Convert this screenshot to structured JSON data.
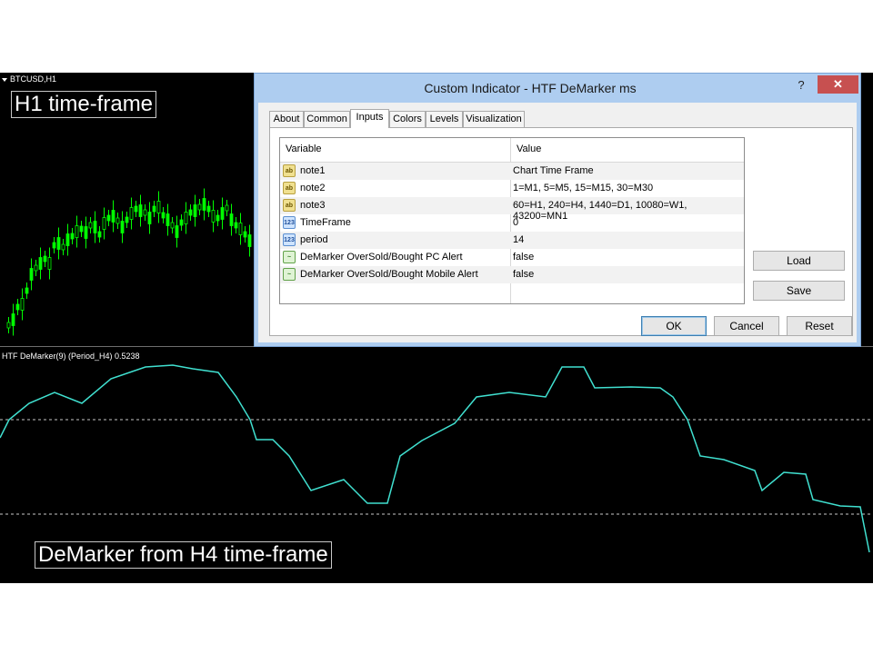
{
  "chart": {
    "symbol": "BTCUSD,H1",
    "top_label": "H1 time-frame",
    "indicator_label": "HTF DeMarker(9) (Period_H4) 0.5238",
    "bottom_label": "DeMarker from H4 time-frame",
    "candle_color": "#00ff00",
    "line_color": "#40e0d0",
    "background": "#000000"
  },
  "dialog": {
    "title": "Custom Indicator - HTF DeMarker ms",
    "help": "?",
    "close": "✕",
    "tabs": [
      {
        "label": "About"
      },
      {
        "label": "Common"
      },
      {
        "label": "Inputs"
      },
      {
        "label": "Colors"
      },
      {
        "label": "Levels"
      },
      {
        "label": "Visualization"
      }
    ],
    "active_tab": "Inputs",
    "grid": {
      "headers": {
        "variable": "Variable",
        "value": "Value"
      },
      "rows": [
        {
          "icon": "ab-icon",
          "variable": "note1",
          "value": "Chart Time Frame"
        },
        {
          "icon": "ab-icon",
          "variable": "note2",
          "value": "1=M1, 5=M5, 15=M15, 30=M30"
        },
        {
          "icon": "ab-icon",
          "variable": "note3",
          "value": "60=H1, 240=H4, 1440=D1, 10080=W1, 43200=MN1"
        },
        {
          "icon": "number-icon",
          "variable": "TimeFrame",
          "value": "0"
        },
        {
          "icon": "number-icon",
          "variable": "period",
          "value": "14"
        },
        {
          "icon": "alert-icon",
          "variable": "DeMarker OverSold/Bought PC Alert",
          "value": "false"
        },
        {
          "icon": "alert-icon",
          "variable": "DeMarker OverSold/Bought Mobile Alert",
          "value": "false"
        }
      ]
    },
    "buttons": {
      "load": "Load",
      "save": "Save",
      "ok": "OK",
      "cancel": "Cancel",
      "reset": "Reset"
    },
    "icon_text": {
      "ab": "ab",
      "num": "123",
      "alert": "~"
    }
  }
}
